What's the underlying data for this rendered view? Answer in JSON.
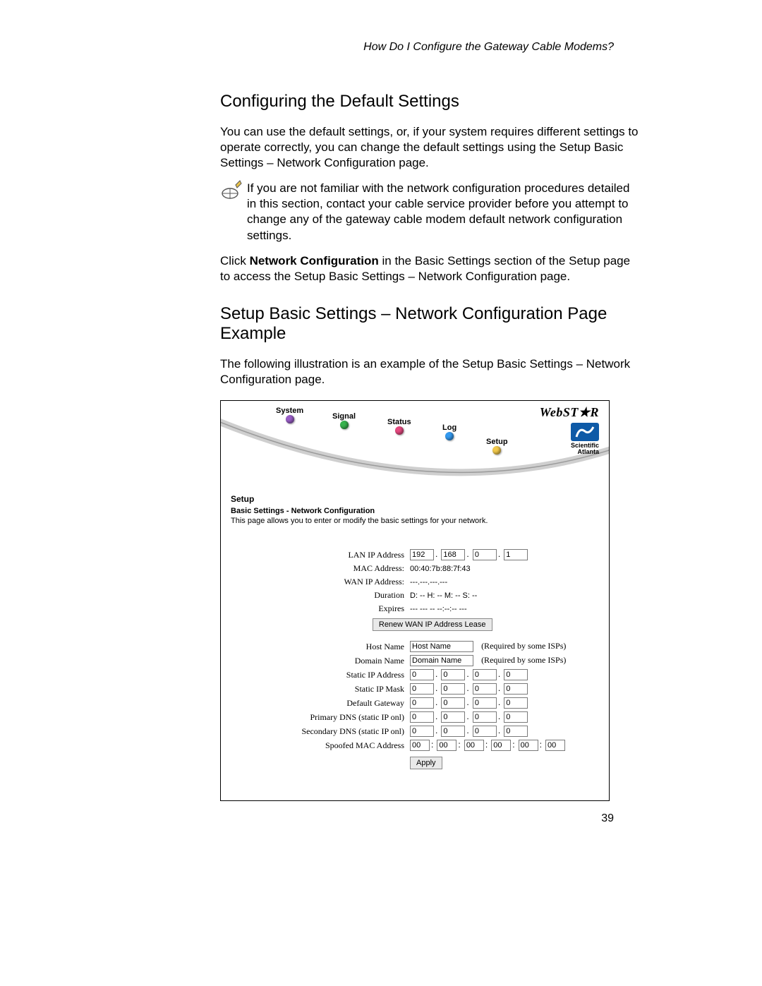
{
  "running_head": "How Do I Configure the Gateway Cable Modems?",
  "page_number": "39",
  "h_default": "Configuring the Default Settings",
  "p_default": "You can use the default settings, or, if your system requires different settings to operate correctly, you can change the default settings using the Setup Basic Settings – Network Configuration page.",
  "p_note": "If you are not familiar with the network configuration procedures detailed in this section, contact your cable service provider before you attempt to change any of the gateway cable modem default network configuration settings.",
  "p_click_a": "Click ",
  "p_click_b": "Network Configuration",
  "p_click_c": " in the Basic Settings section of the Setup page to access the Setup Basic Settings – Network Configuration page.",
  "h_example": "Setup Basic Settings – Network Configuration Page Example",
  "p_example": "The following illustration is an example of the Setup Basic Settings – Network Configuration page.",
  "nav": {
    "system": "System",
    "signal": "Signal",
    "status": "Status",
    "log": "Log",
    "setup": "Setup"
  },
  "brand": {
    "webstar": "WebST★R",
    "sa1": "Scientific",
    "sa2": "Atlanta"
  },
  "panel": {
    "title": "Setup",
    "sub": "Basic Settings - Network Configuration",
    "desc": "This page allows you to enter or modify the basic settings for your network."
  },
  "labels": {
    "lan_ip": "LAN IP Address",
    "mac": "MAC Address:",
    "wan_ip": "WAN IP Address:",
    "duration": "Duration",
    "expires": "Expires",
    "renew": "Renew WAN IP Address Lease",
    "host": "Host Name",
    "domain": "Domain Name",
    "static_ip": "Static IP Address",
    "static_mask": "Static IP Mask",
    "gw": "Default Gateway",
    "dns1": "Primary DNS (static IP onl)",
    "dns2": "Secondary DNS (static IP onl)",
    "spoof": "Spoofed MAC Address",
    "apply": "Apply",
    "req": "(Required by some ISPs)"
  },
  "values": {
    "lan_ip": [
      "192",
      "168",
      "0",
      "1"
    ],
    "mac": "00:40:7b:88:7f:43",
    "wan_ip": "---.---.---.---",
    "duration": "D: -- H: -- M: -- S: --",
    "expires": "--- --- -- --:--:-- ---",
    "host_ph": "Host Name",
    "domain_ph": "Domain Name",
    "zero4": [
      "0",
      "0",
      "0",
      "0"
    ],
    "mac6": [
      "00",
      "00",
      "00",
      "00",
      "00",
      "00"
    ]
  },
  "colors": {
    "orb_system": "#9a5ec8",
    "orb_signal": "#37b24d",
    "orb_status": "#e64980",
    "orb_log": "#339af0",
    "orb_setup": "#f2c94c"
  }
}
